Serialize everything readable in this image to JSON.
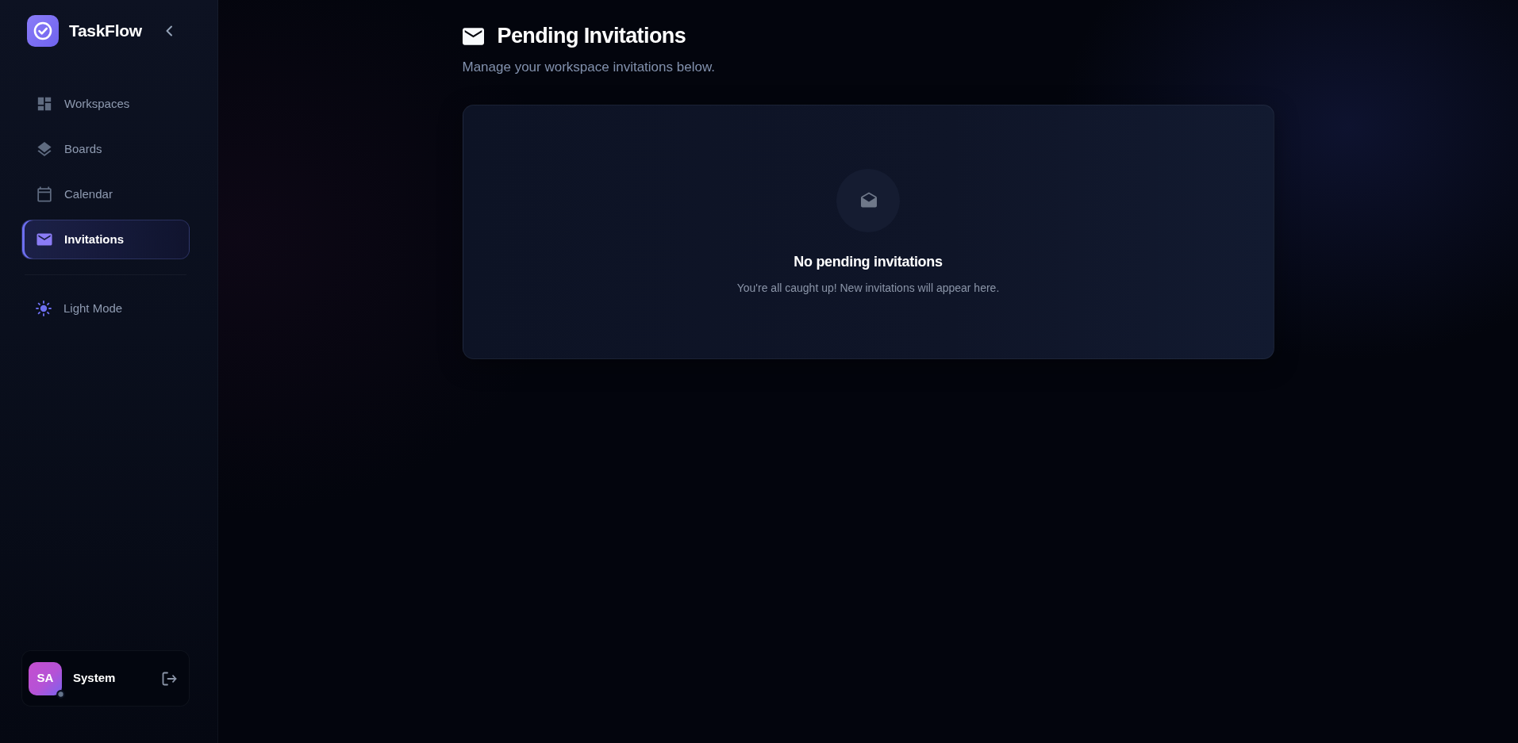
{
  "sidebar": {
    "brand": "TaskFlow",
    "nav_items": [
      {
        "label": "Workspaces",
        "selected": false
      },
      {
        "label": "Boards",
        "selected": false
      },
      {
        "label": "Calendar",
        "selected": false
      },
      {
        "label": "Invitations",
        "selected": true
      }
    ],
    "theme_toggle": {
      "label": "Light Mode"
    },
    "user": {
      "initials": "SA",
      "name": "System",
      "online": false
    }
  },
  "page": {
    "title": "Pending Invitations",
    "subtitle": "Manage your workspace invitations below."
  },
  "empty_state": {
    "title": "No pending invitations",
    "message": "You're all caught up! New invitations will appear here."
  }
}
